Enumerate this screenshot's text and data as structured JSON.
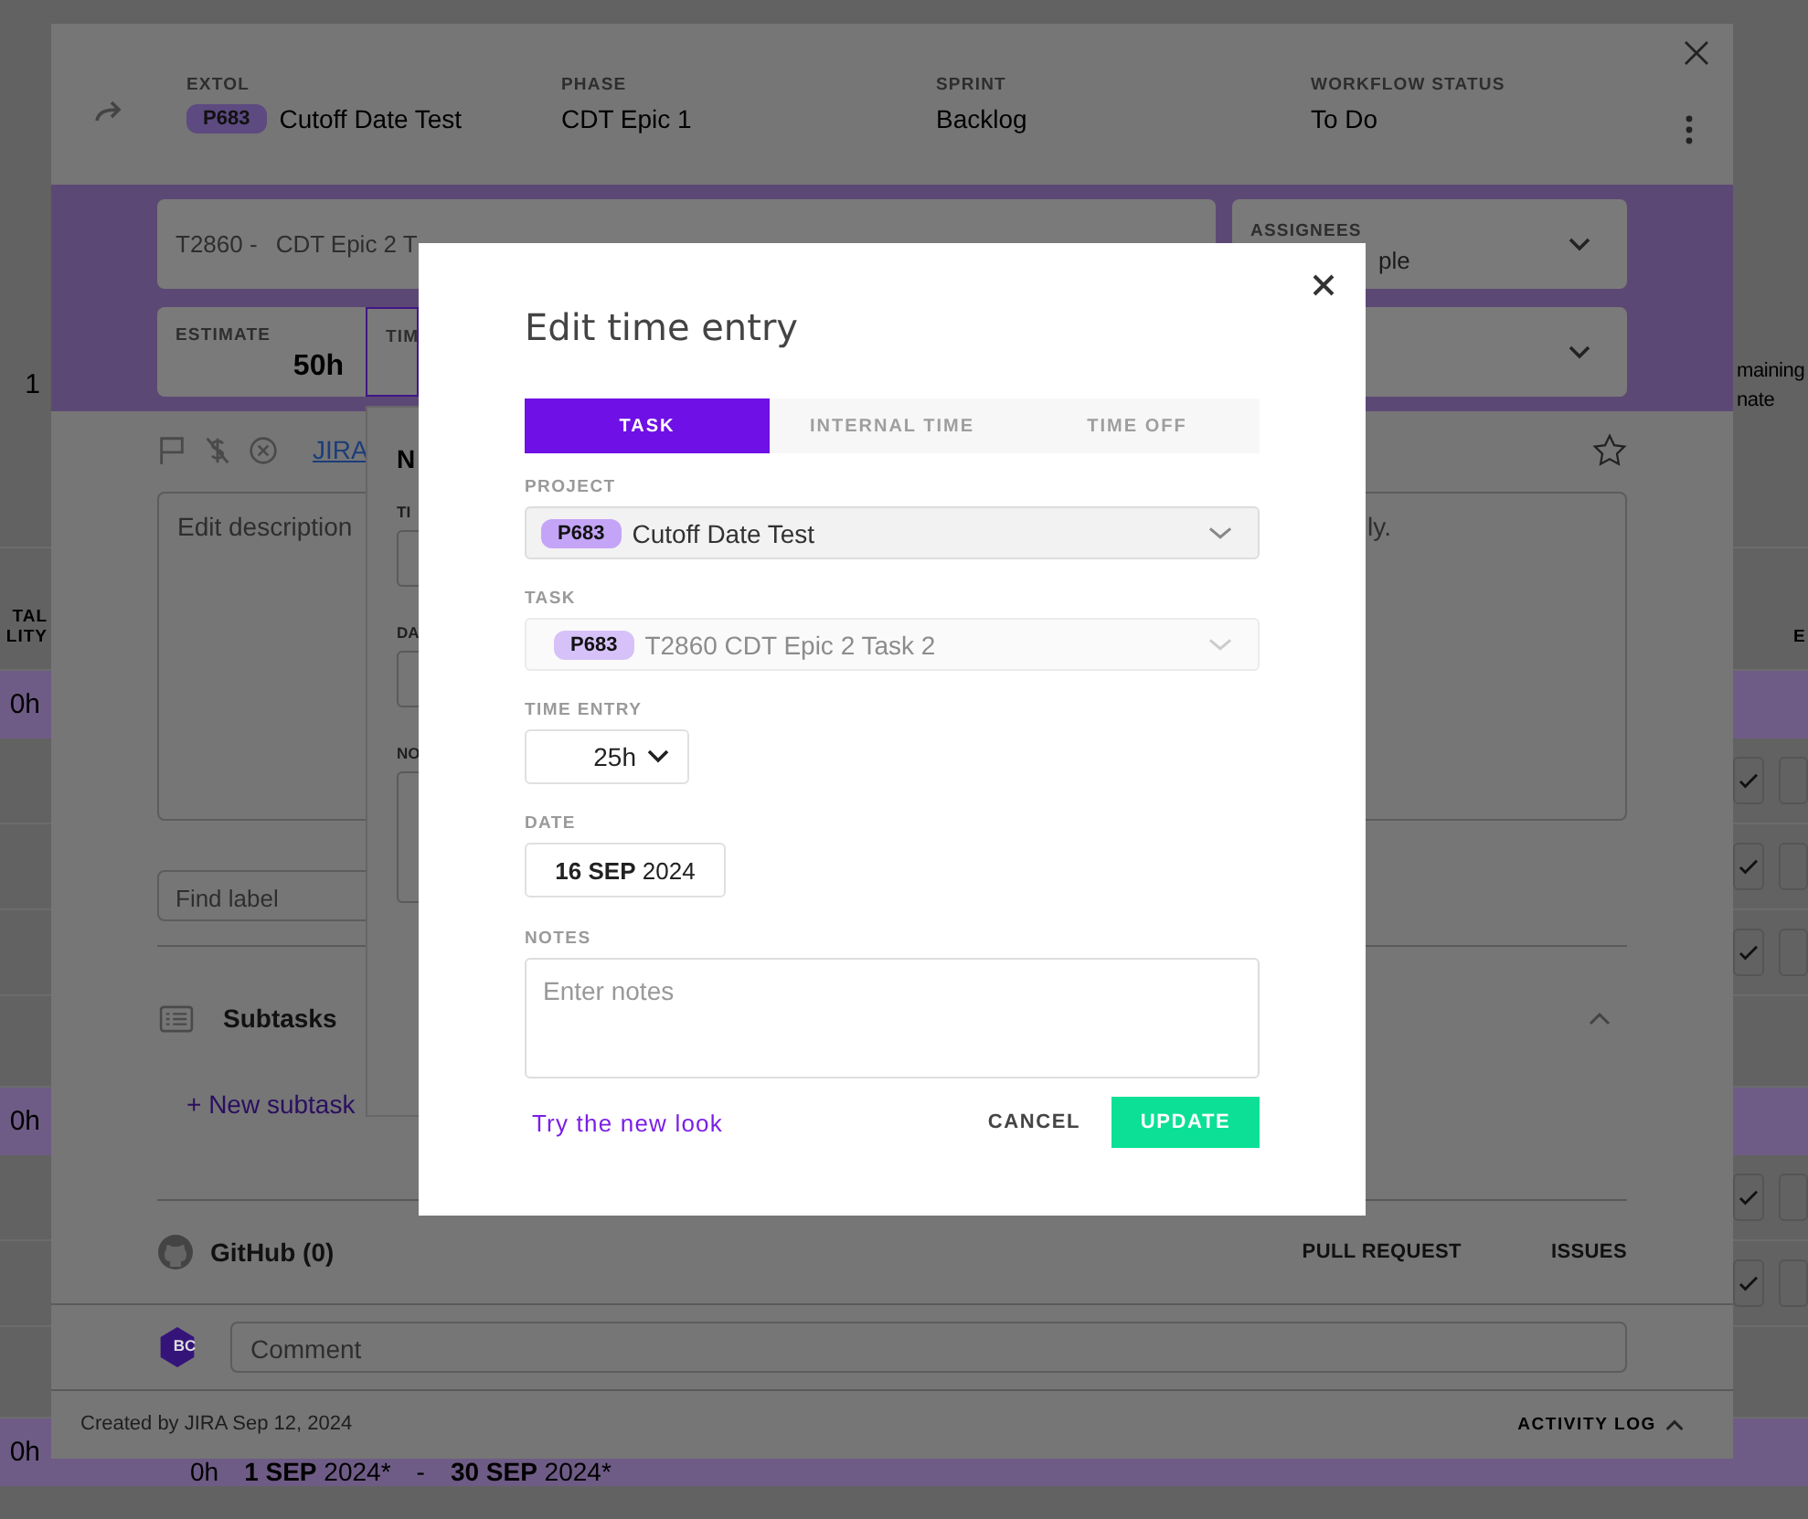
{
  "app_table": {
    "rows": [
      {
        "kind": "task",
        "row_number": "1",
        "trailing": [
          "maining",
          "nate"
        ]
      },
      {
        "kind": "header",
        "heading": [
          "TAL",
          "LITY"
        ],
        "trailing_heading": "E"
      },
      {
        "kind": "summary",
        "total": "0h"
      },
      {
        "kind": "check",
        "checks": [
          {
            "checked": true
          },
          {
            "checked": false
          }
        ]
      },
      {
        "kind": "check",
        "checks": [
          {
            "checked": true
          },
          {
            "checked": false
          }
        ]
      },
      {
        "kind": "check",
        "checks": [
          {
            "checked": true
          },
          {
            "checked": false
          }
        ]
      },
      {
        "kind": "empty"
      },
      {
        "kind": "summary",
        "total": "0h"
      },
      {
        "kind": "check",
        "checks": [
          {
            "checked": true
          },
          {
            "checked": false
          }
        ]
      },
      {
        "kind": "check",
        "checks": [
          {
            "checked": true
          },
          {
            "checked": false
          }
        ]
      },
      {
        "kind": "empty"
      },
      {
        "kind": "summary",
        "total": "0h",
        "hours": "0h",
        "start": "**1 SEP** 2024*",
        "dash": "-",
        "end": "**30 SEP** 2024*"
      }
    ]
  },
  "task_modal": {
    "header": {
      "client_label": "EXTOL",
      "project_code": "P683",
      "project_name": "Cutoff Date Test",
      "fields": [
        {
          "label": "PHASE",
          "value": "CDT Epic 1"
        },
        {
          "label": "SPRINT",
          "value": "Backlog"
        },
        {
          "label": "WORKFLOW STATUS",
          "value": "To Do"
        }
      ]
    },
    "title_field": {
      "code": "T2860 -",
      "name": "CDT Epic 2 T"
    },
    "assignees": {
      "label": "ASSIGNEES",
      "value": "ple"
    },
    "estimate": {
      "label": "ESTIMATE",
      "value": "50h"
    },
    "time_field": {
      "label": "TIM"
    },
    "jira_link": "JIRA",
    "starred": false,
    "description": {
      "placeholder": "Edit description",
      "trailing": "ly."
    },
    "label_search": {
      "placeholder": "Find label"
    },
    "subtasks": {
      "title": "Subtasks",
      "expanded": true,
      "new_link": "+ New subtask"
    },
    "github": {
      "title": "GitHub (0)",
      "tabs": [
        "PULL REQUEST",
        "ISSUES"
      ]
    },
    "comment": {
      "avatar": "BC",
      "placeholder": "Comment"
    },
    "footer": {
      "created": "Created by JIRA Sep 12, 2024",
      "activity_log": "ACTIVITY LOG"
    }
  },
  "time_popup": {
    "title": "N",
    "fields": [
      "TI",
      "DA",
      "NO"
    ]
  },
  "edit_dialog": {
    "title": "Edit time entry",
    "tabs": [
      {
        "label": "TASK",
        "selected": true
      },
      {
        "label": "INTERNAL TIME",
        "selected": false
      },
      {
        "label": "TIME OFF",
        "selected": false
      }
    ],
    "selects": [
      {
        "label": "PROJECT",
        "code": "P683",
        "name": "Cutoff Date Test",
        "disabled": false
      },
      {
        "label": "TASK",
        "code": "P683",
        "name": "T2860 CDT Epic 2 Task 2",
        "disabled": true
      }
    ],
    "time_entry": {
      "label": "TIME ENTRY",
      "value": "25h"
    },
    "date": {
      "label": "DATE",
      "value": "**16 SEP** 2024"
    },
    "notes": {
      "label": "NOTES",
      "placeholder": "Enter notes"
    },
    "new_look_link": "Try the new look",
    "buttons": {
      "cancel": "CANCEL",
      "update": "UPDATE"
    }
  }
}
